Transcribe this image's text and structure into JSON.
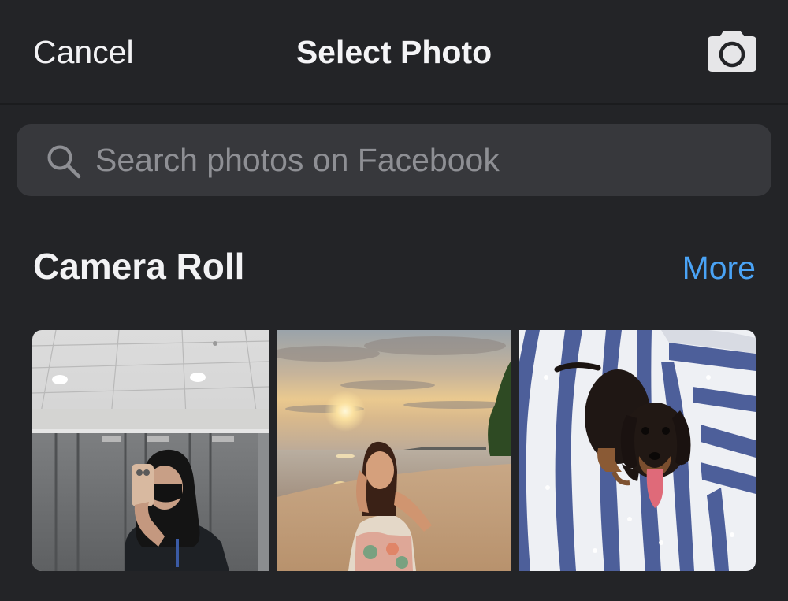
{
  "header": {
    "cancel_label": "Cancel",
    "title": "Select Photo",
    "camera_icon": "camera-icon"
  },
  "search": {
    "placeholder": "Search photos on Facebook",
    "value": "",
    "icon": "search-icon"
  },
  "camera_roll": {
    "title": "Camera Roll",
    "more_label": "More",
    "photos": [
      {
        "subject": "mirror selfie in restroom"
      },
      {
        "subject": "woman at beach during sunset"
      },
      {
        "subject": "dachshund on striped blanket"
      }
    ]
  },
  "colors": {
    "background": "#232427",
    "search_background": "#37383c",
    "link_blue": "#4aa3f5",
    "text": "#f2f2f4",
    "placeholder": "#8e8f94"
  }
}
